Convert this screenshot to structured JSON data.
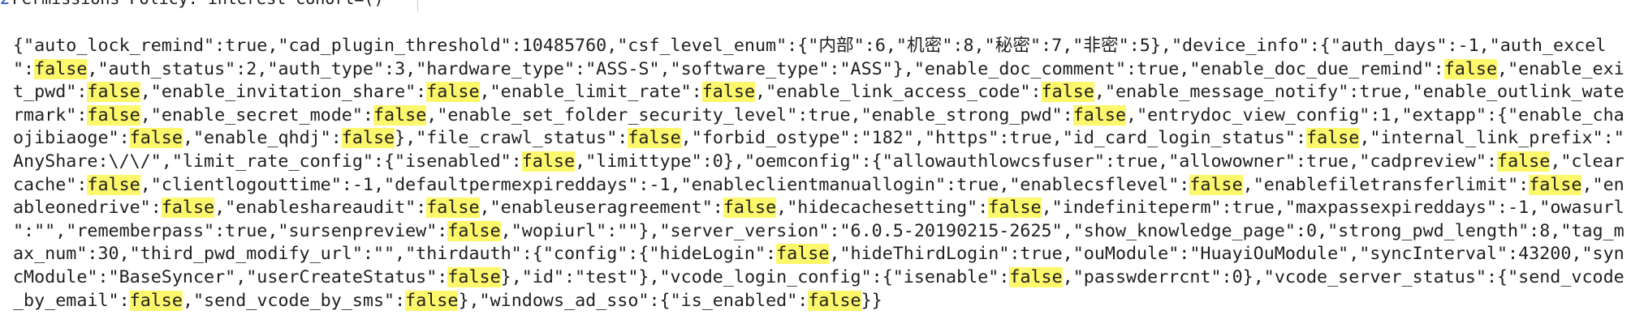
{
  "header": {
    "gutter": "2",
    "text": "Permissions-Policy: interest-cohort=()"
  },
  "highlight_color": "#fdf76b",
  "search_term": "false",
  "json_lines": [
    [
      {
        "t": "{\"auto_lock_remind\":true,\"cad_plugin_threshold\":10485760,\"csf_level_enum\":{\"内部\":6,\"机密\":8,\"秘密\":7,\"非密\":5},\"device_info\":{\"auth_days\":-1,\"auth_excel"
      }
    ],
    [
      {
        "t": "\":"
      },
      {
        "t": "false",
        "hl": true
      },
      {
        "t": ",\"auth_status\":2,\"auth_type\":3,\"hardware_type\":\"ASS-S\",\"software_type\":\"ASS\"},\"enable_doc_comment\":true,\"enable_doc_due_remind\":"
      },
      {
        "t": "false",
        "hl": true
      },
      {
        "t": ",\"enable_exi"
      }
    ],
    [
      {
        "t": "t_pwd\":"
      },
      {
        "t": "false",
        "hl": true
      },
      {
        "t": ",\"enable_invitation_share\":"
      },
      {
        "t": "false",
        "hl": true
      },
      {
        "t": ",\"enable_limit_rate\":"
      },
      {
        "t": "false",
        "hl": true
      },
      {
        "t": ",\"enable_link_access_code\":"
      },
      {
        "t": "false",
        "hl": true
      },
      {
        "t": ",\"enable_message_notify\":true,\"enable_outlink_wate"
      }
    ],
    [
      {
        "t": "rmark\":"
      },
      {
        "t": "false",
        "hl": true
      },
      {
        "t": ",\"enable_secret_mode\":"
      },
      {
        "t": "false",
        "hl": true
      },
      {
        "t": ",\"enable_set_folder_security_level\":true,\"enable_strong_pwd\":"
      },
      {
        "t": "false",
        "hl": true
      },
      {
        "t": ",\"entrydoc_view_config\":1,\"extapp\":{\"enable_cha"
      }
    ],
    [
      {
        "t": "ojibiaoge\":"
      },
      {
        "t": "false",
        "hl": true
      },
      {
        "t": ",\"enable_qhdj\":"
      },
      {
        "t": "false",
        "hl": true
      },
      {
        "t": "},\"file_crawl_status\":"
      },
      {
        "t": "false",
        "hl": true
      },
      {
        "t": ",\"forbid_ostype\":\"182\",\"https\":true,\"id_card_login_status\":"
      },
      {
        "t": "false",
        "hl": true
      },
      {
        "t": ",\"internal_link_prefix\":\""
      }
    ],
    [
      {
        "t": "AnyShare:\\/\\/\",\"limit_rate_config\":{\"isenabled\":"
      },
      {
        "t": "false",
        "hl": true
      },
      {
        "t": ",\"limittype\":0},\"oemconfig\":{\"allowauthlowcsfuser\":true,\"allowowner\":true,\"cadpreview\":"
      },
      {
        "t": "false",
        "hl": true
      },
      {
        "t": ",\"clear"
      }
    ],
    [
      {
        "t": "cache\":"
      },
      {
        "t": "false",
        "hl": true
      },
      {
        "t": ",\"clientlogouttime\":-1,\"defaultpermexpireddays\":-1,\"enableclientmanuallogin\":true,\"enablecsflevel\":"
      },
      {
        "t": "false",
        "hl": true
      },
      {
        "t": ",\"enablefiletransferlimit\":"
      },
      {
        "t": "false",
        "hl": true
      },
      {
        "t": ",\"en"
      }
    ],
    [
      {
        "t": "ableonedrive\":"
      },
      {
        "t": "false",
        "hl": true
      },
      {
        "t": ",\"enableshareaudit\":"
      },
      {
        "t": "false",
        "hl": true
      },
      {
        "t": ",\"enableuseragreement\":"
      },
      {
        "t": "false",
        "hl": true
      },
      {
        "t": ",\"hidecachesetting\":"
      },
      {
        "t": "false",
        "hl": true
      },
      {
        "t": ",\"indefiniteperm\":true,\"maxpassexpireddays\":-1,\"owasurl"
      }
    ],
    [
      {
        "t": "\":\"\",\"rememberpass\":true,\"sursenpreview\":"
      },
      {
        "t": "false",
        "hl": true
      },
      {
        "t": ",\"wopiurl\":\"\"},\"server_version\":\"6.0.5-20190215-2625\",\"show_knowledge_page\":0,\"strong_pwd_length\":8,\"tag_m"
      }
    ],
    [
      {
        "t": "ax_num\":30,\"third_pwd_modify_url\":\"\",\"thirdauth\":{\"config\":{\"hideLogin\":"
      },
      {
        "t": "false",
        "hl": true
      },
      {
        "t": ",\"hideThirdLogin\":true,\"ouModule\":\"HuayiOuModule\",\"syncInterval\":43200,\"syn"
      }
    ],
    [
      {
        "t": "cModule\":\"BaseSyncer\",\"userCreateStatus\":"
      },
      {
        "t": "false",
        "hl": true
      },
      {
        "t": "},\"id\":\"test\"},\"vcode_login_config\":{\"isenable\":"
      },
      {
        "t": "false",
        "hl": true
      },
      {
        "t": ",\"passwderrcnt\":0},\"vcode_server_status\":{\"send_vcode"
      }
    ],
    [
      {
        "t": "_by_email\":"
      },
      {
        "t": "false",
        "hl": true
      },
      {
        "t": ",\"send_vcode_by_sms\":"
      },
      {
        "t": "false",
        "hl": true
      },
      {
        "t": "},\"windows_ad_sso\":{\"is_enabled\":"
      },
      {
        "t": "false",
        "hl": true
      },
      {
        "t": "}}"
      }
    ]
  ]
}
